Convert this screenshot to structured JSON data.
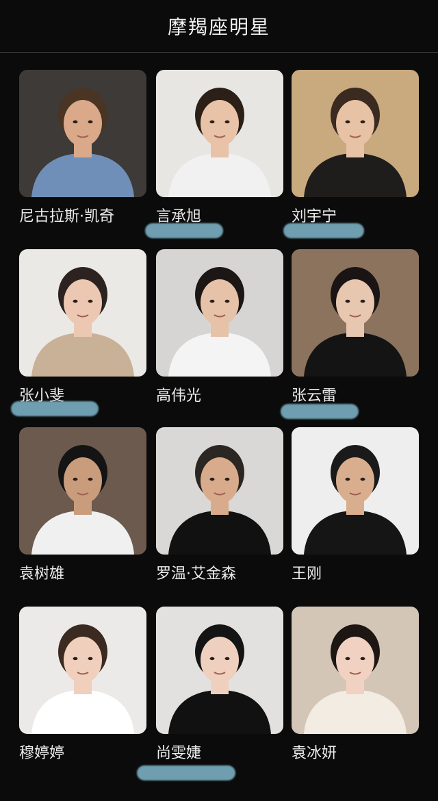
{
  "header": {
    "title": "摩羯座明星"
  },
  "celebrities": [
    {
      "name": "尼古拉斯·凯奇",
      "bg": "#3d3a37",
      "skin": "#d9a98a",
      "hair": "#4a3525",
      "shirt": "#6f8fb8"
    },
    {
      "name": "言承旭",
      "bg": "#e8e6e3",
      "skin": "#e8c3a8",
      "hair": "#2b1f18",
      "shirt": "#f1f1f1"
    },
    {
      "name": "刘宇宁",
      "bg": "#c9a97e",
      "skin": "#e7c2a4",
      "hair": "#3a2a20",
      "shirt": "#1f1c1c"
    },
    {
      "name": "张小斐",
      "bg": "#ebe9e6",
      "skin": "#ecc8b2",
      "hair": "#2c2220",
      "shirt": "#c8b197"
    },
    {
      "name": "高伟光",
      "bg": "#d7d5d3",
      "skin": "#e5c2a8",
      "hair": "#1c1715",
      "shirt": "#f4f4f4"
    },
    {
      "name": "张云雷",
      "bg": "#8c735d",
      "skin": "#e8c7b0",
      "hair": "#1a1514",
      "shirt": "#141414"
    },
    {
      "name": "袁树雄",
      "bg": "#6b5a4d",
      "skin": "#c99c7c",
      "hair": "#141414",
      "shirt": "#f0f0f0"
    },
    {
      "name": "罗温·艾金森",
      "bg": "#d9d8d6",
      "skin": "#d8ab8c",
      "hair": "#2b2622",
      "shirt": "#111111"
    },
    {
      "name": "王刚",
      "bg": "#eeeeee",
      "skin": "#d9ae8f",
      "hair": "#1a1a1a",
      "shirt": "#151515"
    },
    {
      "name": "穆婷婷",
      "bg": "#eceae8",
      "skin": "#f0cfbd",
      "hair": "#3b2a20",
      "shirt": "#ffffff"
    },
    {
      "name": "尚雯婕",
      "bg": "#e2e1df",
      "skin": "#efd0bf",
      "hair": "#141414",
      "shirt": "#111111"
    },
    {
      "name": "袁冰妍",
      "bg": "#d4c6b7",
      "skin": "#f1d2c2",
      "hair": "#1d1613",
      "shirt": "#f3ece3"
    }
  ],
  "accent_scribble_color": "#8fd0e6"
}
